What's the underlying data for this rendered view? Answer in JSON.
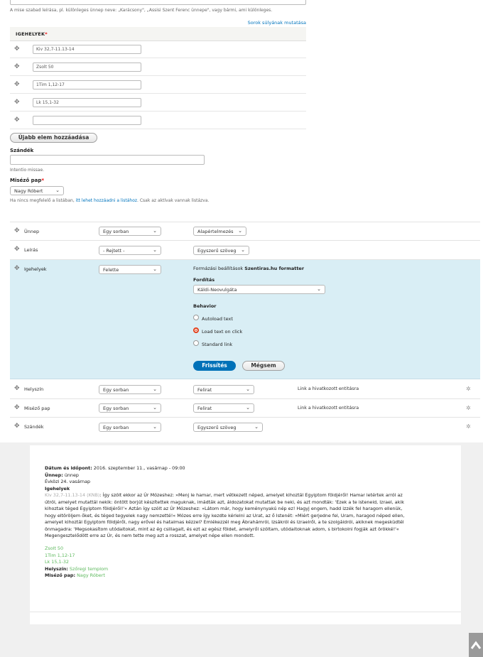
{
  "top": {
    "hint": "A mise szabad leírása, pl. különleges ünnep neve: „Karácsony\", „Assisi Szent Ferenc ünnepe\", vagy bármi, ami különleges.",
    "row_weights_link": "Sorok súlyának mutatása"
  },
  "igehelyek": {
    "header": "IGEHELYEK",
    "required_mark": "*",
    "items": [
      "Kiv 32,7-11.13-14",
      "Zsolt 50",
      "1Tim 1,12-17",
      "Lk 15,1-32",
      ""
    ],
    "add_button": "Újabb elem hozzáadása"
  },
  "szandek": {
    "label": "Szándék",
    "value": "",
    "desc": "Intentio missae."
  },
  "misezo": {
    "label": "Miséző pap",
    "required_mark": "*",
    "value": "Nagy Róbert",
    "desc_pre": "Ha nincs megfelelő a listában, ",
    "desc_link": "itt lehet hozzáadni a listához",
    "desc_post": ". Csak az aktívak vannak listázva."
  },
  "fields": [
    {
      "name": "Ünnep",
      "label_mode": "Egy sorban",
      "format": "Alapértelmezés",
      "summary": ""
    },
    {
      "name": "Leírás",
      "label_mode": "- Rejtett -",
      "format": "Egyszerű szöveg",
      "summary": ""
    },
    {
      "name": "Helyszín",
      "label_mode": "Egy sorban",
      "format": "Felirat",
      "summary": "Link a hivatkozott entitásra"
    },
    {
      "name": "Miséző pap",
      "label_mode": "Egy sorban",
      "format": "Felirat",
      "summary": "Link a hivatkozott entitásra"
    },
    {
      "name": "Szándék",
      "label_mode": "Egy sorban",
      "format": "Egyszerű szöveg",
      "summary": ""
    }
  ],
  "igehelyek_field": {
    "name": "Igehelyek",
    "label_mode": "Felette",
    "settings_prefix": "Formázási beállítások",
    "formatter": "Szentiras.hu formatter",
    "translation_label": "Fordítás",
    "translation_value": "Káldi-Neovulgáta",
    "behavior_label": "Behavior",
    "behavior_options": [
      "Autoload text",
      "Load text on click",
      "Standard link"
    ],
    "selected_behavior": 1,
    "update_button": "Frissítés",
    "cancel_button": "Mégsem"
  },
  "preview": {
    "date_label": "Dátum és időpont:",
    "date_value": "2016. szeptember 11., vasárnap - 09:00",
    "unnep_label": "Ünnep:",
    "unnep_value": "ünnep",
    "evkozi": "Évközi 24. vasárnap",
    "igehelyek_label": "Igehelyek",
    "ref": "Kiv 32,7-11.13-14 (KNB)",
    "text_lines": [
      ": Így szólt ekkor az Úr Mózeshez: »Menj le hamar, mert vétkezett néped, amelyet kihoztál Egyiptom földjéről! Hamar letértek arról az",
      "útról, amelyet mutattál nekik: öntött borjút készítettek maguknak, imádták azt, áldozatokat mutattak be neki, és azt mondták: 'Ezek a te isteneid, Izrael, akik",
      "kihoztak téged Egyiptom földjéről!'« Aztán így szólt az Úr Mózeshez: »Látom már, hogy keménynyakú nép ez! Hagyj engem, hadd izzék fel haragom ellenük,",
      "hogy eltöröljem őket, és téged tegyelek nagy nemzetté!« Mózes erre így kezdte kérlelni az Urat, az ő Istenét: »Miért gerjedne fel, Uram, haragod néped ellen,",
      "amelyet kihoztál Egyiptom földjéről, nagy erővel és hatalmas kézzel? Emlékezzél meg Ábrahámról, Izsákról és Izraelről, a te szolgáidról, akiknek megesküdtél",
      "önmagadra: 'Megsokasítom utódaitokat, mint az ég csillagait, és ezt az egész földet, amelyről szóltam, utódaitoknak adom, s birtokolni fogják azt örökké!'«",
      "Megengesztelődött erre az Úr, és nem tette meg azt a rosszat, amelyet népe ellen mondott."
    ],
    "links": [
      "Zsolt 50",
      "1Tim 1,12-17",
      "Lk 15,1-32"
    ],
    "helyszin_label": "Helyszín:",
    "helyszin_value": "Szőregi templom",
    "misezo_label": "Miséző pap:",
    "misezo_value": "Nagy Róbert"
  },
  "colors": {
    "accent": "#0074bd",
    "panel": "#d9eef5",
    "preview_bg": "#f0f0f0",
    "link_green": "#5cb85c",
    "radio_on": "#e2401c"
  },
  "icons": [
    "drag-handle-icon",
    "chevron-down-icon",
    "gear-icon",
    "back-to-top-icon"
  ]
}
